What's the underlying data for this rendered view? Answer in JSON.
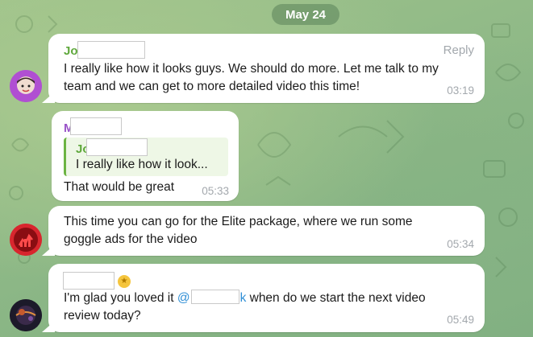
{
  "chat": {
    "date_label": "May 24",
    "messages": [
      {
        "sender_visible": "Jo",
        "sender_color": "#5fa83c",
        "reply_label": "Reply",
        "lines": [
          "I really like how it looks guys. We should do more. Let me talk to my",
          "team and we can get to more detailed video this time!"
        ],
        "time": "03:19",
        "avatar_icon": "avatar-purple-character"
      },
      {
        "sender_visible": "M",
        "sender_color": "#9a54c8",
        "quote": {
          "sender_visible": "Jo",
          "text": "I really like how it look..."
        },
        "lines": [
          "That would be great"
        ],
        "time": "05:33"
      },
      {
        "lines": [
          "This time you can go for the Elite package, where we run some",
          "goggle ads for the video"
        ],
        "time": "05:34",
        "avatar_icon": "avatar-red-logo"
      },
      {
        "sender_emoji_icon": "star-emoji-badge",
        "line1_prefix": "I'm glad you loved it ",
        "mention_at": "@",
        "mention_tail": "k",
        "line1_suffix": " when do we start the next video",
        "line2": "review today?",
        "time": "05:49",
        "avatar_icon": "avatar-dark-planet"
      }
    ]
  },
  "colors": {
    "bubble": "#ffffff",
    "quote_bar": "#6cb443",
    "mention": "#2f8fd6",
    "timestamp": "#a3a8ad"
  }
}
